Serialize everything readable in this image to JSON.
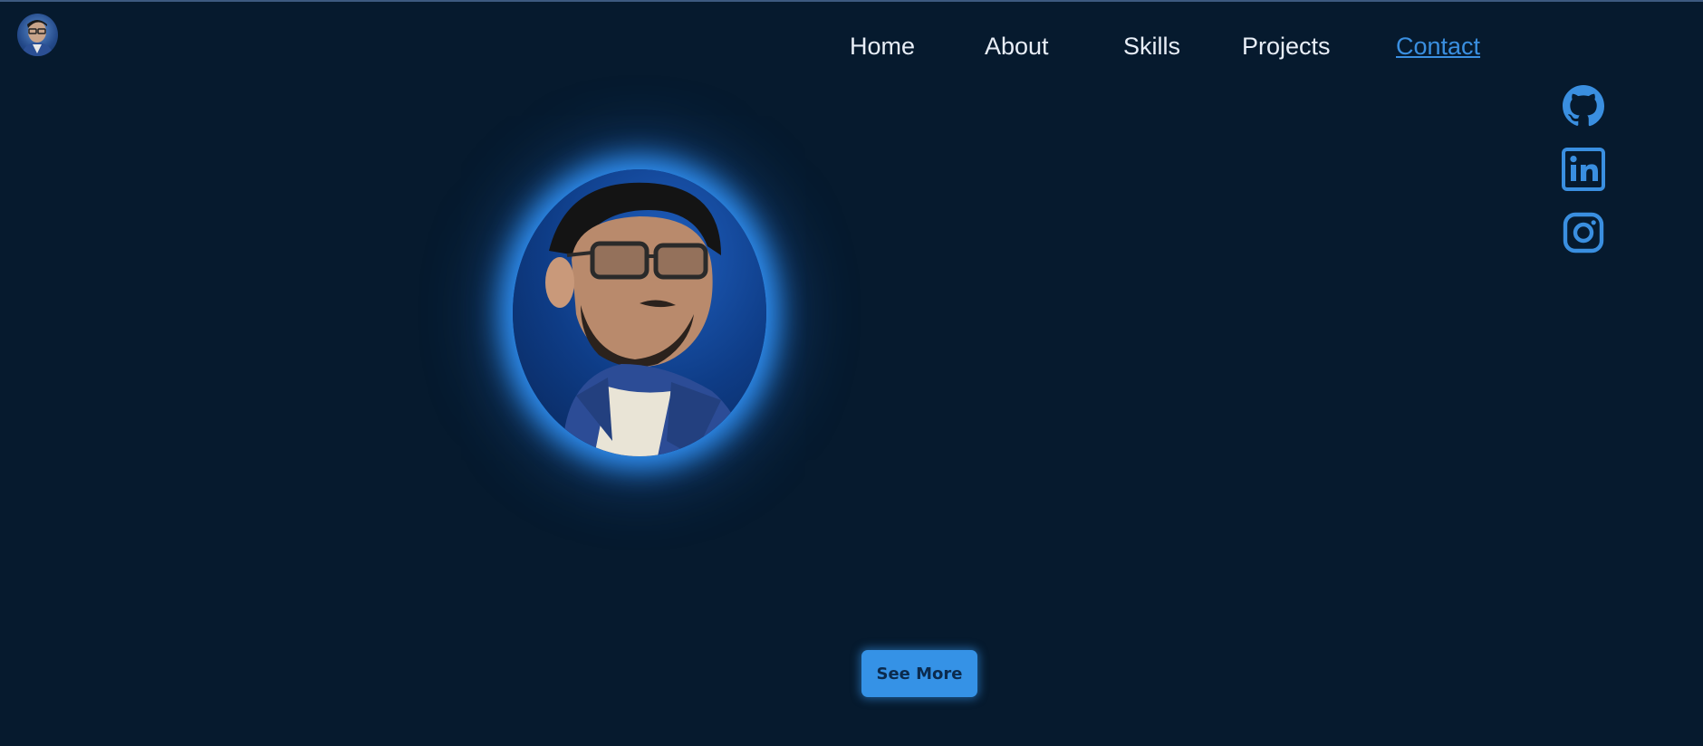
{
  "header": {
    "logo_icon": "avatar-icon"
  },
  "nav": {
    "items": [
      {
        "label": "Home"
      },
      {
        "label": "About"
      },
      {
        "label": "Skills"
      },
      {
        "label": "Projects"
      },
      {
        "label": "Contact",
        "active": true
      }
    ]
  },
  "social": {
    "items": [
      {
        "icon": "github-icon"
      },
      {
        "icon": "linkedin-icon"
      },
      {
        "icon": "instagram-icon"
      }
    ]
  },
  "hero": {
    "photo_icon": "profile-photo",
    "button_label": "See More"
  },
  "colors": {
    "background": "#061a2e",
    "accent": "#3592e6",
    "nav_text": "#e8eef7",
    "active_link": "#3a8fe0"
  }
}
